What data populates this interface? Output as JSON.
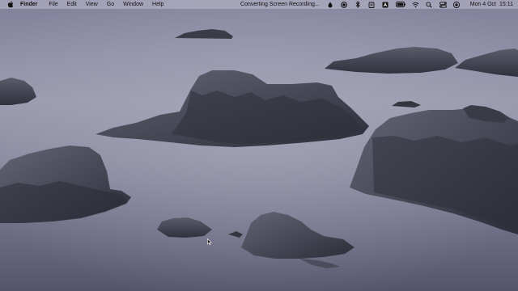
{
  "menubar": {
    "app_name": "Finder",
    "menus": [
      "File",
      "Edit",
      "View",
      "Go",
      "Window",
      "Help"
    ],
    "status_text": "Converting Screen Recording...",
    "tray_icons": [
      "dropbox-icon",
      "record-icon",
      "bluetooth-icon",
      "clipboard-icon",
      "text-icon",
      "battery-icon",
      "wifi-icon",
      "search-icon",
      "control-center-icon",
      "siri-icon"
    ],
    "date": "Mon 4 Oct",
    "time": "15:11"
  },
  "colors": {
    "sky_top": "#7f7f99",
    "water_mid": "#9a9aae",
    "water_bottom": "#55546a",
    "rock": "#3d3e4b"
  }
}
